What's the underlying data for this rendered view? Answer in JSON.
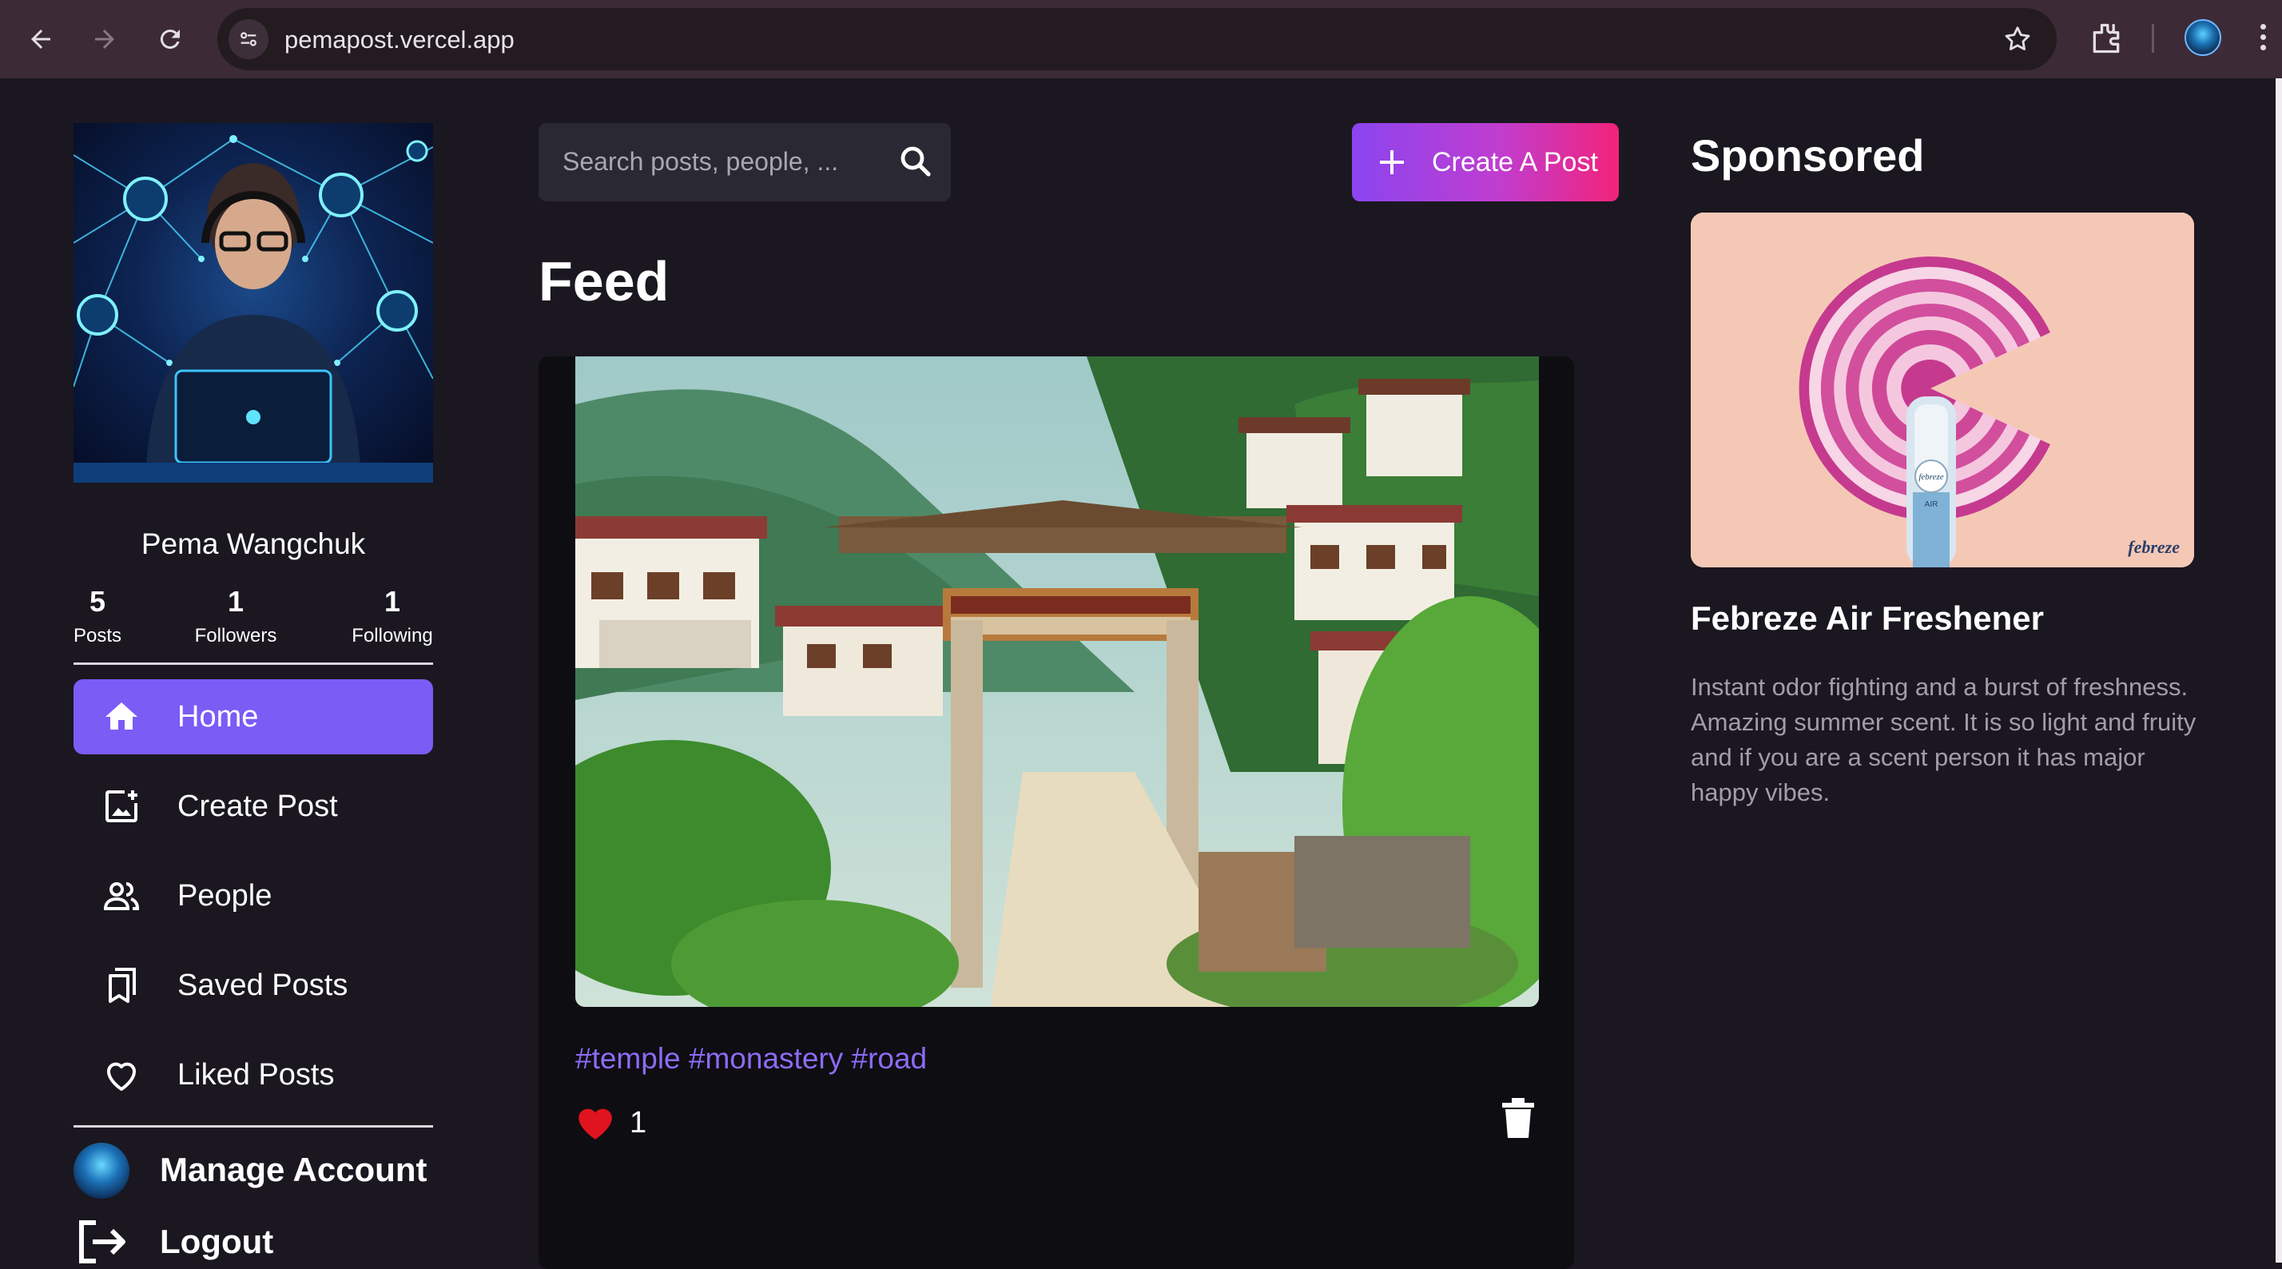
{
  "browser": {
    "url": "pemapost.vercel.app",
    "icons": [
      "back-icon",
      "forward-icon",
      "reload-icon",
      "site-settings-icon",
      "bookmark-star-icon",
      "extensions-icon",
      "profile-avatar",
      "more-menu-icon"
    ]
  },
  "sidebar": {
    "user_name": "Pema Wangchuk",
    "stats": [
      {
        "value": "5",
        "label": "Posts"
      },
      {
        "value": "1",
        "label": "Followers"
      },
      {
        "value": "1",
        "label": "Following"
      }
    ],
    "nav": [
      {
        "label": "Home",
        "icon": "home-icon",
        "active": true
      },
      {
        "label": "Create Post",
        "icon": "add-photo-icon",
        "active": false
      },
      {
        "label": "People",
        "icon": "people-icon",
        "active": false
      },
      {
        "label": "Saved Posts",
        "icon": "bookmarks-icon",
        "active": false
      },
      {
        "label": "Liked Posts",
        "icon": "heart-outline-icon",
        "active": false
      }
    ],
    "manage_account": "Manage Account",
    "logout": "Logout"
  },
  "main": {
    "search_placeholder": "Search posts, people, ...",
    "create_button": "Create A Post",
    "feed_title": "Feed",
    "post": {
      "tags": "#temple #monastery #road",
      "like_count": "1"
    }
  },
  "sponsored": {
    "title": "Sponsored",
    "ad_name": "Febreze Air Freshener",
    "ad_description": "Instant odor fighting and a burst of freshness. Amazing summer scent. It is so light and fruity and if you are a scent person it has major happy vibes.",
    "ad_logo_text": "febreze",
    "ad_bottle_text": "AIR"
  },
  "colors": {
    "accent": "#7b5cf5",
    "background": "#1a1720",
    "card": "#0e0d12",
    "tag": "#8b6cf7",
    "like": "#e0141e"
  }
}
